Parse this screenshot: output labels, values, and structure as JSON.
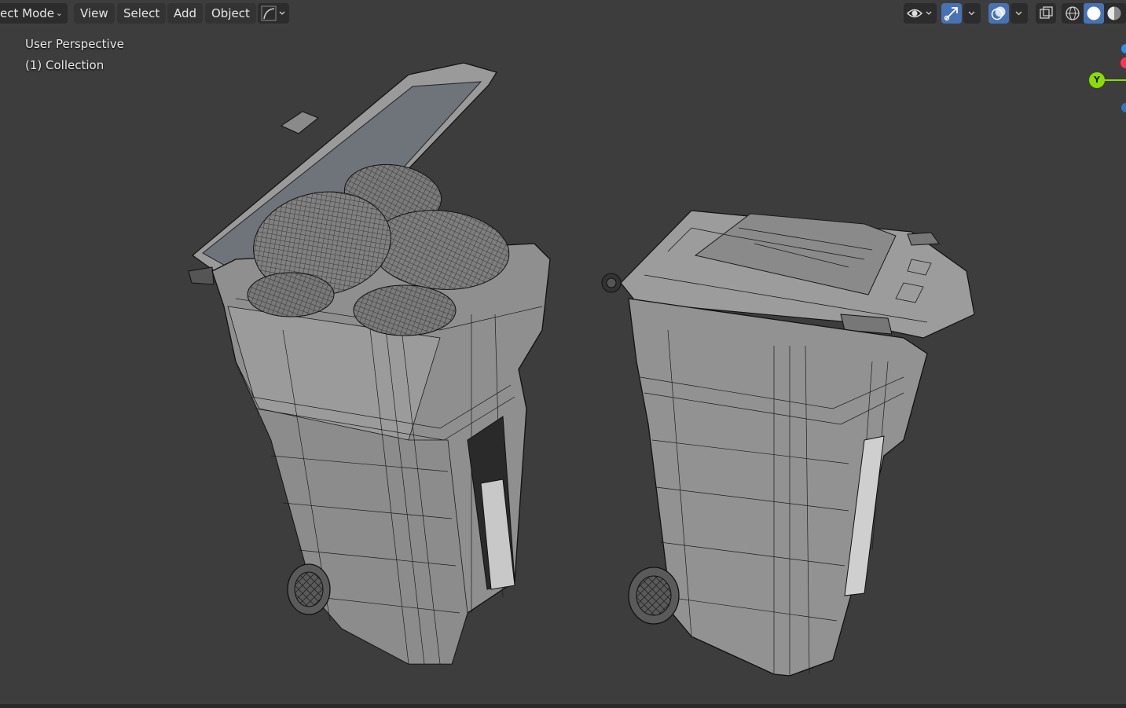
{
  "header": {
    "mode_label": "ect Mode",
    "menus": [
      "View",
      "Select",
      "Add",
      "Object"
    ]
  },
  "viewport": {
    "perspective_label": "User Perspective",
    "collection_label": "(1) Collection",
    "gizmo_axis_label": "Y"
  },
  "colors": {
    "background": "#3d3d3d",
    "header_button": "#2c2c2c",
    "active_blue": "#4772b3",
    "gizmo_y": "#8bdc00",
    "gizmo_x": "#ff3352",
    "gizmo_z": "#2b8dff"
  },
  "icons": [
    "visibility-icon",
    "gizmo-toggle-icon",
    "overlays-icon",
    "xray-icon",
    "wireframe-shading-icon",
    "solid-shading-icon",
    "material-shading-icon"
  ]
}
